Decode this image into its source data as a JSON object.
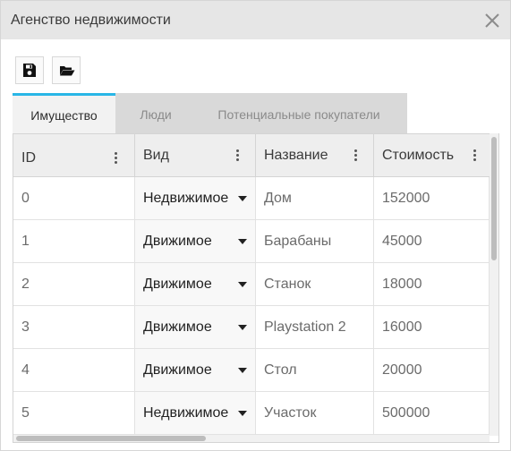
{
  "window": {
    "title": "Агенство недвижимости"
  },
  "toolbar": {
    "save_icon": "save-icon",
    "open_icon": "folder-open-icon"
  },
  "tabs": [
    {
      "label": "Имущество",
      "active": true
    },
    {
      "label": "Люди",
      "active": false
    },
    {
      "label": "Потенциальные покупатели",
      "active": false
    }
  ],
  "colors": {
    "accent": "#29b6e6",
    "titlebar": "#e6e6e6",
    "header": "#eeeeee"
  },
  "table": {
    "columns": [
      "ID",
      "Вид",
      "Название",
      "Стоимость"
    ],
    "rows": [
      {
        "id": "0",
        "kind": "Недвижимое",
        "name": "Дом",
        "price": "152000"
      },
      {
        "id": "1",
        "kind": "Движимое",
        "name": "Барабаны",
        "price": "45000"
      },
      {
        "id": "2",
        "kind": "Движимое",
        "name": "Станок",
        "price": "18000"
      },
      {
        "id": "3",
        "kind": "Движимое",
        "name": "Playstation 2",
        "price": "16000"
      },
      {
        "id": "4",
        "kind": "Движимое",
        "name": "Стол",
        "price": "20000"
      },
      {
        "id": "5",
        "kind": "Недвижимое",
        "name": "Участок",
        "price": "500000"
      }
    ]
  }
}
